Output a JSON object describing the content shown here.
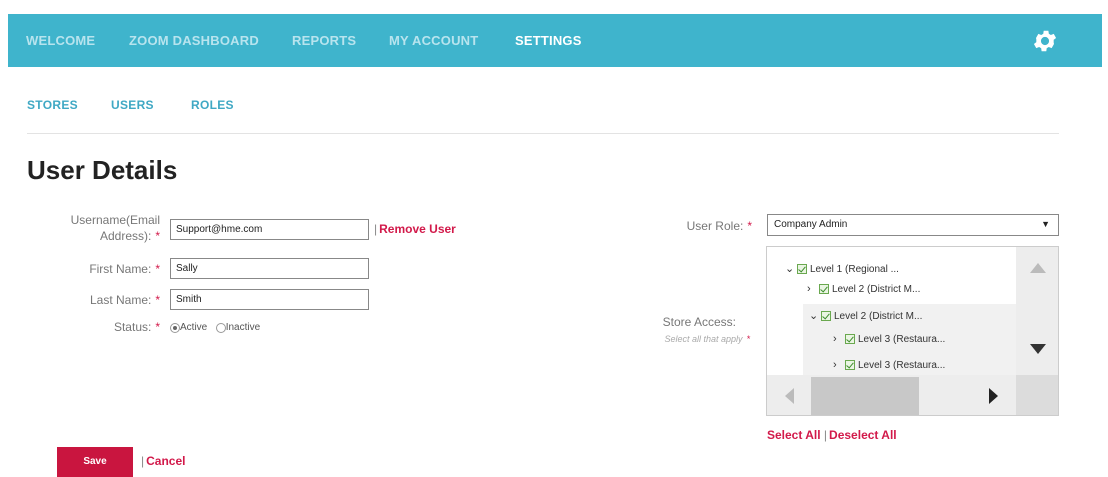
{
  "nav": {
    "items": [
      "WELCOME",
      "ZOOM DASHBOARD",
      "REPORTS",
      "MY ACCOUNT",
      "SETTINGS"
    ],
    "active": "SETTINGS",
    "bar_color": "#3fb4cc"
  },
  "subnav": {
    "items": [
      "STORES",
      "USERS",
      "ROLES"
    ]
  },
  "page": {
    "title": "User Details"
  },
  "form": {
    "username_label": "Username(Email Address):",
    "username_value": "Support@hme.com",
    "remove_user": "Remove User",
    "first_name_label": "First Name:",
    "first_name_value": "Sally",
    "last_name_label": "Last Name:",
    "last_name_value": "Smith",
    "status_label": "Status:",
    "status_active": "Active",
    "status_inactive": "Inactive",
    "status_selected": "Active",
    "required_marker": "*"
  },
  "role": {
    "label": "User Role:",
    "selected": "Company Admin"
  },
  "store_access": {
    "label": "Store Access:",
    "hint": "Select all that apply",
    "tree": [
      {
        "label": "Level 1 (Regional ...",
        "expanded": true,
        "checked": true
      },
      {
        "label": "Level 2 (District M...",
        "expanded": false,
        "checked": true
      },
      {
        "label": "Level 2 (District M...",
        "expanded": true,
        "checked": true
      },
      {
        "label": "Level 3 (Restaura...",
        "expanded": false,
        "checked": true
      },
      {
        "label": "Level 3 (Restaura...",
        "expanded": false,
        "checked": true
      }
    ],
    "select_all": "Select All",
    "deselect_all": "Deselect All"
  },
  "actions": {
    "save": "Save",
    "cancel": "Cancel"
  },
  "colors": {
    "accent": "#3fb4cc",
    "danger": "#d2194a",
    "save_bg": "#c9153f"
  },
  "icons": {
    "settings": "gear-icon"
  }
}
